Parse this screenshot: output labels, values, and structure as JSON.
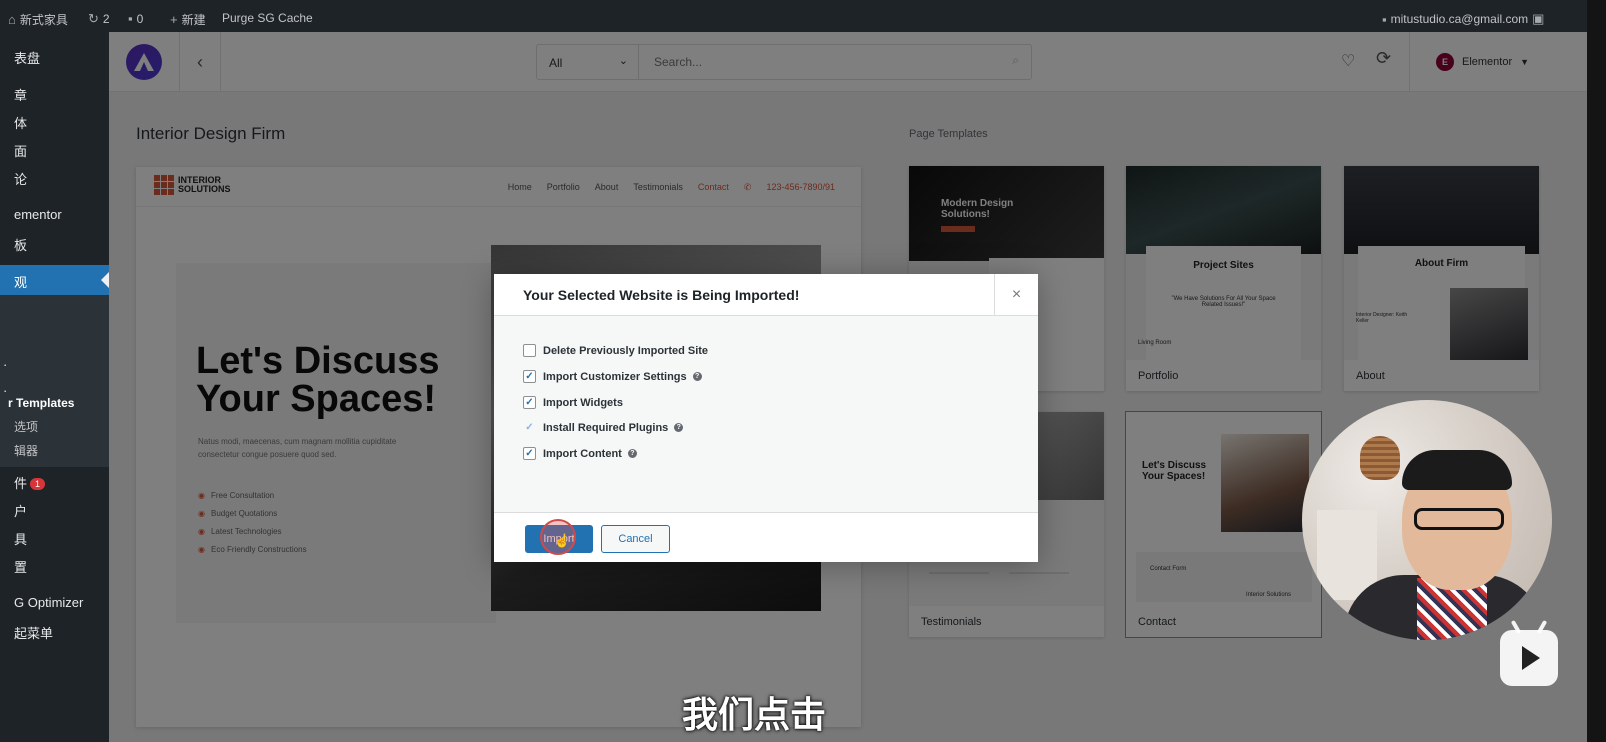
{
  "admin_bar": {
    "site_name": "新式家具",
    "updates_count": "2",
    "comments_count": "0",
    "new_label": "新建",
    "purge_label": "Purge SG Cache",
    "user_email": "mitustudio.ca@gmail.com"
  },
  "wp_menu": {
    "items": [
      {
        "label": "表盘"
      },
      {
        "label": "章"
      },
      {
        "label": "体"
      },
      {
        "label": "面"
      },
      {
        "label": "论"
      },
      {
        "label": "ementor"
      },
      {
        "label": "板"
      },
      {
        "label": "观"
      },
      {
        "label": "r Templates"
      },
      {
        "label": "选项"
      },
      {
        "label": "辑器"
      },
      {
        "label": "件"
      },
      {
        "label": "户"
      },
      {
        "label": "具"
      },
      {
        "label": "置"
      },
      {
        "label": "G Optimizer"
      },
      {
        "label": "起菜单"
      }
    ],
    "plugins_badge": "1"
  },
  "topbar": {
    "type_select": "All",
    "search_placeholder": "Search...",
    "builder_label": "Elementor",
    "builder_icon_text": "E"
  },
  "site_title": "Interior Design Firm",
  "page_templates_label": "Page Templates",
  "preview": {
    "logo_line1": "INTERIOR",
    "logo_line2": "SOLUTIONS",
    "nav": [
      "Home",
      "Portfolio",
      "About",
      "Testimonials",
      "Contact"
    ],
    "phone": "123-456-7890/91",
    "hero_heading": "Let's Discuss Your Spaces!",
    "hero_para": "Natus modi, maecenas, cum magnam mollitia cupiditate consectetur congue posuere quod sed.",
    "features": [
      "Free Consultation",
      "Budget Quotations",
      "Latest Technologies",
      "Eco Friendly Constructions"
    ]
  },
  "templates": [
    {
      "label": "",
      "heading": "Modern Design Solutions!"
    },
    {
      "label": "Portfolio",
      "heading": "Project Sites",
      "quote": "\"We Have Solutions For All Your Space Related Issues!\"",
      "caption": "Living Room"
    },
    {
      "label": "About",
      "heading": "About Firm",
      "caption": "Interior Designer: Keith Keller"
    },
    {
      "label": "Testimonials"
    },
    {
      "label": "Contact",
      "heading": "Let's Discuss Your Spaces!",
      "caption": "Contact Form",
      "caption2": "Interior Solutions"
    }
  ],
  "modal": {
    "title": "Your Selected Website is Being Imported!",
    "close_icon": "×",
    "options": [
      {
        "label": "Delete Previously Imported Site",
        "checked": false,
        "help": false
      },
      {
        "label": "Import Customizer Settings",
        "checked": true,
        "help": true
      },
      {
        "label": "Import Widgets",
        "checked": true,
        "help": false
      },
      {
        "label": "Install Required Plugins",
        "checked": true,
        "help": true
      },
      {
        "label": "Import Content",
        "checked": true,
        "help": true
      }
    ],
    "import_label": "Import",
    "cancel_label": "Cancel"
  },
  "video_subtitle": "我们点击",
  "colors": {
    "accent": "#2271b1",
    "wp_dark": "#1d2327",
    "brand": "#d9583b"
  }
}
